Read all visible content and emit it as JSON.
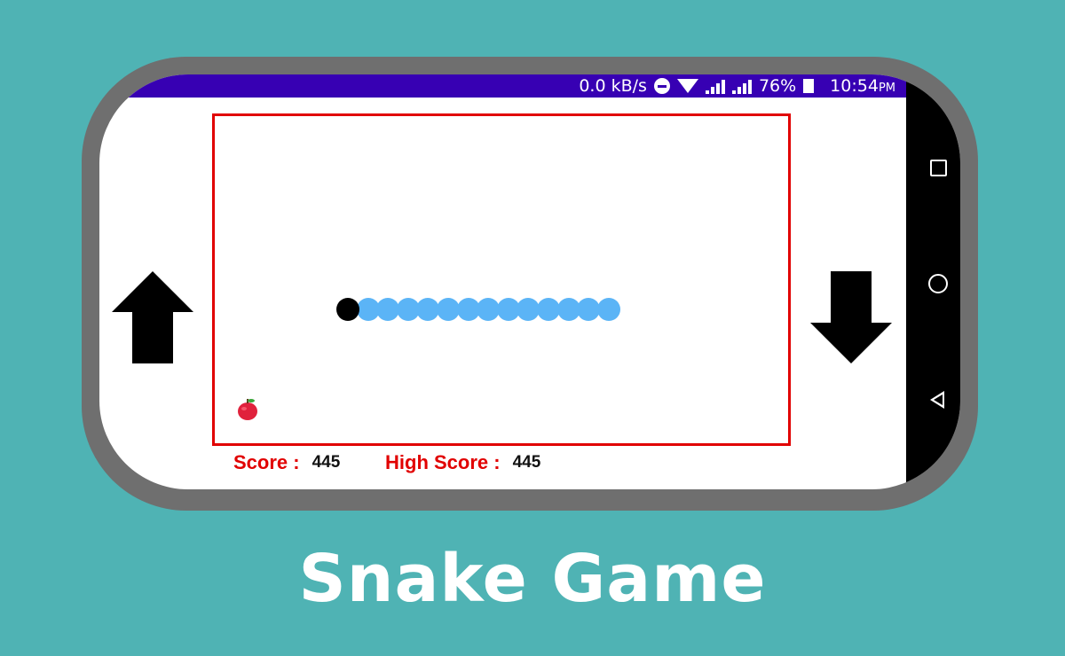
{
  "status_bar": {
    "speed": "0.0 kB/s",
    "battery": "76%",
    "time": "10:54",
    "ampm": "PM",
    "icons": [
      "do-not-disturb-icon",
      "wifi-icon",
      "signal-icon",
      "signal-icon",
      "battery-icon"
    ]
  },
  "controls": {
    "up_icon": "arrow-up-icon",
    "down_icon": "arrow-down-icon"
  },
  "nav_bar": {
    "icons": [
      "recents-square-icon",
      "home-circle-icon",
      "back-triangle-icon"
    ]
  },
  "game": {
    "board_border_color": "#e10000",
    "snake_body_color": "#5bb4f6",
    "snake_head_color": "#000000",
    "snake_length": 14,
    "food_icon": "apple-icon"
  },
  "scores": {
    "score_label": "Score :",
    "score_value": "445",
    "high_score_label": "High Score :",
    "high_score_value": "445"
  },
  "title": "Snake Game",
  "colors": {
    "background": "#4fb3b4",
    "status_bar": "#3700b3",
    "accent_red": "#e10000"
  }
}
